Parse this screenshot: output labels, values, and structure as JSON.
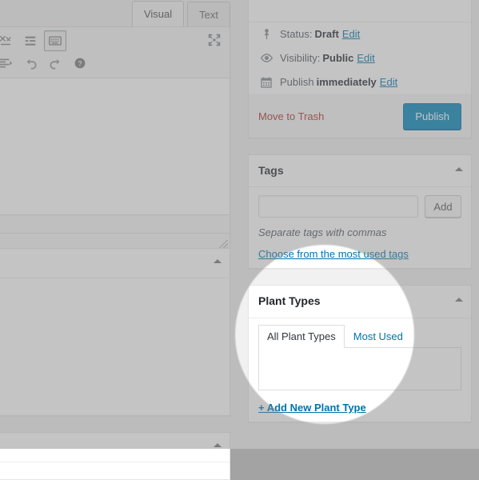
{
  "editor": {
    "tabs": [
      {
        "label": "Visual",
        "active": true
      },
      {
        "label": "Text",
        "active": false
      }
    ],
    "toolbar_row1": [
      {
        "name": "remove-formatting-icon",
        "title": "Clear formatting"
      },
      {
        "name": "horizontal-line-icon",
        "title": "Horizontal line"
      },
      {
        "name": "keyboard-shortcuts-icon",
        "title": "Keyboard shortcuts",
        "pressed": true
      }
    ],
    "toolbar_row2": [
      {
        "name": "outdent-icon",
        "title": "Decrease indent"
      },
      {
        "name": "undo-icon",
        "title": "Undo"
      },
      {
        "name": "redo-icon",
        "title": "Redo"
      },
      {
        "name": "help-icon",
        "title": "Help"
      }
    ],
    "fullscreen": {
      "name": "distraction-free-icon",
      "title": "Distraction-free writing mode"
    }
  },
  "publish_box": {
    "status": {
      "icon": "post-status-icon",
      "label": "Status:",
      "value": "Draft",
      "edit": "Edit"
    },
    "visibility": {
      "icon": "visibility-eye-icon",
      "label": "Visibility:",
      "value": "Public",
      "edit": "Edit"
    },
    "schedule": {
      "icon": "calendar-icon",
      "label": "Publish",
      "value": "immediately",
      "edit": "Edit"
    },
    "trash_label": "Move to Trash",
    "publish_label": "Publish"
  },
  "tags_box": {
    "title": "Tags",
    "input_value": "",
    "input_placeholder": "",
    "add_label": "Add",
    "hint": "Separate tags with commas",
    "most_used_link": "Choose from the most used tags"
  },
  "plant_types_box": {
    "title": "Plant Types",
    "tabs": [
      {
        "label": "All Plant Types",
        "active": true
      },
      {
        "label": "Most Used",
        "active": false
      }
    ],
    "terms": [],
    "add_new_link": "+ Add New Plant Type"
  },
  "colors": {
    "accent": "#0073aa",
    "publish_button": "#0085ba",
    "trash": "#b32d2e",
    "page_background": "#f1f1f1",
    "dim_overlay": "#808080"
  }
}
